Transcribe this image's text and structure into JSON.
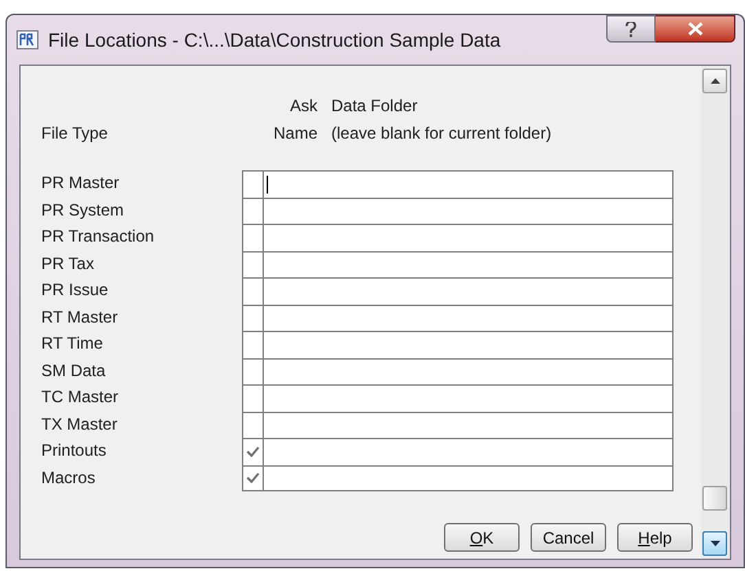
{
  "window": {
    "title": "File Locations - C:\\...\\Data\\Construction Sample Data"
  },
  "headers": {
    "file_type": "File Type",
    "ask_name": [
      "Ask",
      "Name"
    ],
    "data_folder": [
      "Data Folder",
      "(leave blank for current folder)"
    ]
  },
  "rows": [
    {
      "file_type": "PR Master",
      "ask_name": false,
      "focused": true
    },
    {
      "file_type": "PR System",
      "ask_name": false,
      "focused": false
    },
    {
      "file_type": "PR Transaction",
      "ask_name": false,
      "focused": false
    },
    {
      "file_type": "PR Tax",
      "ask_name": false,
      "focused": false
    },
    {
      "file_type": "PR Issue",
      "ask_name": false,
      "focused": false
    },
    {
      "file_type": "RT Master",
      "ask_name": false,
      "focused": false
    },
    {
      "file_type": "RT Time",
      "ask_name": false,
      "focused": false
    },
    {
      "file_type": "SM Data",
      "ask_name": false,
      "focused": false
    },
    {
      "file_type": "TC Master",
      "ask_name": false,
      "focused": false
    },
    {
      "file_type": "TX Master",
      "ask_name": false,
      "focused": false
    },
    {
      "file_type": "Printouts",
      "ask_name": true,
      "focused": false
    },
    {
      "file_type": "Macros",
      "ask_name": true,
      "focused": false
    }
  ],
  "buttons": [
    {
      "label": "OK",
      "access_key": true
    },
    {
      "label": "Cancel",
      "access_key": false
    },
    {
      "label": "Help",
      "access_key": true
    }
  ]
}
